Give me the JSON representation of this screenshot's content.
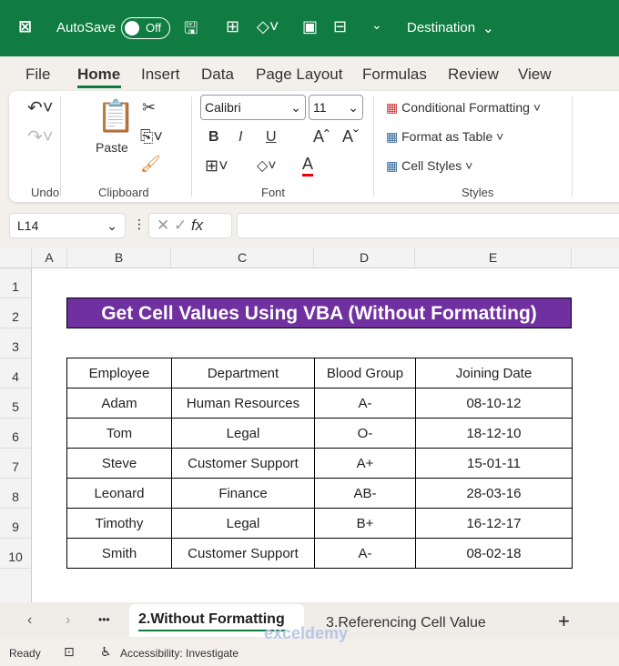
{
  "titlebar": {
    "autosave": "AutoSave",
    "toggle": "Off",
    "doc": "Destination"
  },
  "menu": [
    "File",
    "Home",
    "Insert",
    "Data",
    "Page Layout",
    "Formulas",
    "Review",
    "View"
  ],
  "ribbon": {
    "paste": "Paste",
    "font": "Calibri",
    "size": "11",
    "bold": "B",
    "italic": "I",
    "underline": "U",
    "cond": "Conditional Formatting",
    "fat": "Format as Table",
    "styles": "Cell Styles",
    "groups": [
      "Undo",
      "Clipboard",
      "Font",
      "Styles"
    ]
  },
  "formula": {
    "namebox": "L14",
    "fx": "fx",
    "value": ""
  },
  "columns": [
    "A",
    "B",
    "C",
    "D",
    "E"
  ],
  "rows": [
    "1",
    "2",
    "3",
    "4",
    "5",
    "6",
    "7",
    "8",
    "9",
    "10"
  ],
  "title": "Get Cell Values Using VBA (Without Formatting)",
  "table": {
    "headers": [
      "Employee",
      "Department",
      "Blood Group",
      "Joining Date"
    ],
    "rows": [
      [
        "Adam",
        "Human Resources",
        "A-",
        "08-10-12"
      ],
      [
        "Tom",
        "Legal",
        "O-",
        "18-12-10"
      ],
      [
        "Steve",
        "Customer Support",
        "A+",
        "15-01-11"
      ],
      [
        "Leonard",
        "Finance",
        "AB-",
        "28-03-16"
      ],
      [
        "Timothy",
        "Legal",
        "B+",
        "16-12-17"
      ],
      [
        "Smith",
        "Customer Support",
        "A-",
        "08-02-18"
      ]
    ]
  },
  "tabs": {
    "active": "2.Without Formatting",
    "other": "3.Referencing Cell Value",
    "add": "+",
    "more": "•••"
  },
  "status": {
    "ready": "Ready",
    "accessibility": "Accessibility: Investigate"
  },
  "watermark": "exceldemy"
}
